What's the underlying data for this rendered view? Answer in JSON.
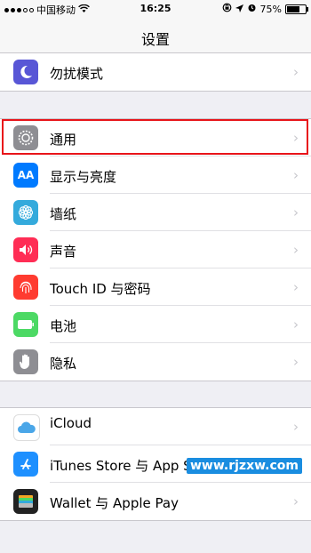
{
  "statusbar": {
    "carrier": "中国移动",
    "time": "16:25",
    "battery": "75%",
    "battery_level": 0.75
  },
  "nav": {
    "title": "设置"
  },
  "group1": [
    {
      "label": "勿扰模式",
      "icon": "moon-icon",
      "color": "#5856d6"
    }
  ],
  "group2": [
    {
      "label": "通用",
      "icon": "gear-icon",
      "color": "#8e8e93"
    },
    {
      "label": "显示与亮度",
      "icon": "display-aa-icon",
      "color": "#007aff"
    },
    {
      "label": "墙纸",
      "icon": "wallpaper-flower-icon",
      "color": "#34aadc"
    },
    {
      "label": "声音",
      "icon": "speaker-icon",
      "color": "#ff2d55"
    },
    {
      "label": "Touch ID 与密码",
      "icon": "fingerprint-icon",
      "color": "#ff3b30"
    },
    {
      "label": "电池",
      "icon": "battery-icon",
      "color": "#4cd964"
    },
    {
      "label": "隐私",
      "icon": "hand-icon",
      "color": "#8e8e93"
    }
  ],
  "group3": [
    {
      "label": "iCloud",
      "icon": "cloud-icon",
      "color": "#ffffff"
    },
    {
      "label": "iTunes Store 与 App Store",
      "icon": "app-store-icon",
      "color": "#1e90ff"
    },
    {
      "label": "Wallet 与 Apple Pay",
      "icon": "wallet-icon",
      "color": "#222222"
    }
  ],
  "watermark": "www.rjzxw.com"
}
